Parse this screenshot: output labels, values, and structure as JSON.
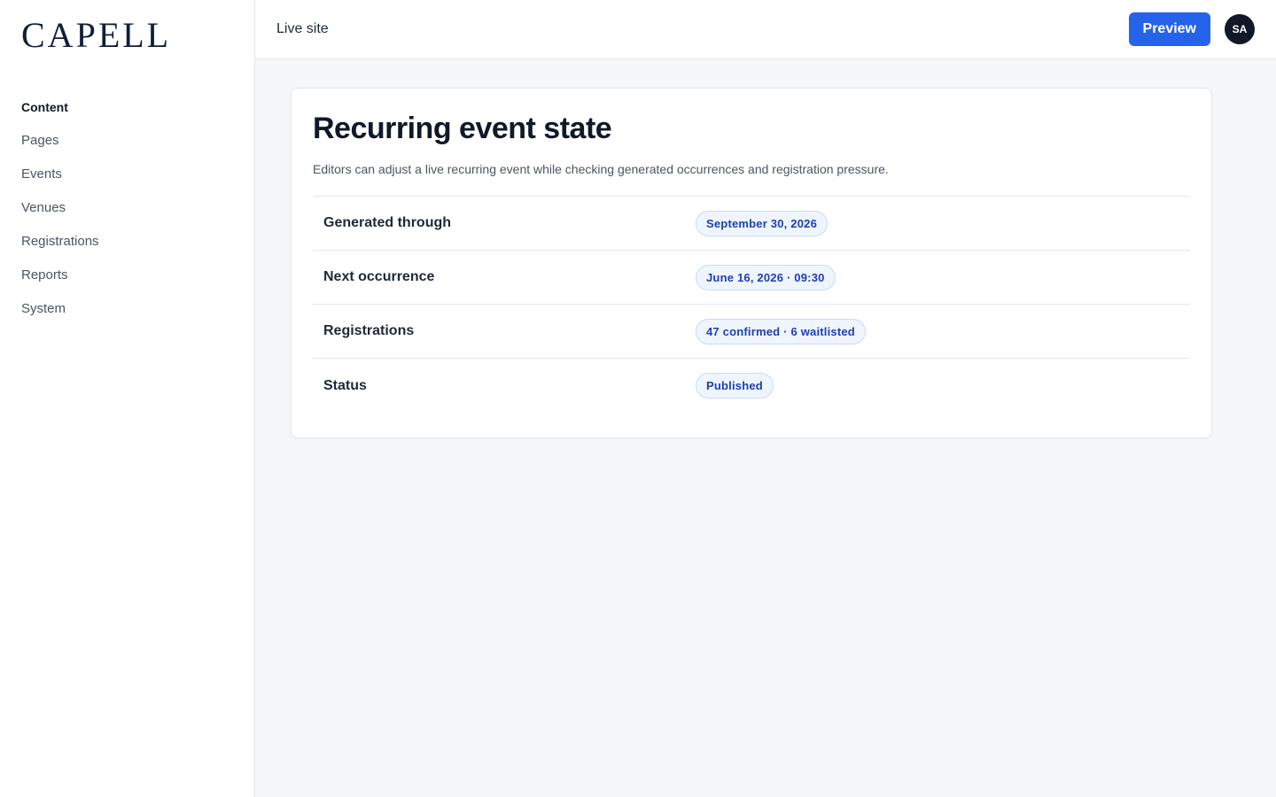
{
  "brand": {
    "logo_text": "CAPELL"
  },
  "sidebar": {
    "heading": "Content",
    "items": [
      {
        "label": "Pages"
      },
      {
        "label": "Events"
      },
      {
        "label": "Venues"
      },
      {
        "label": "Registrations"
      },
      {
        "label": "Reports"
      },
      {
        "label": "System"
      }
    ]
  },
  "topbar": {
    "live_site_label": "Live site",
    "preview_label": "Preview",
    "avatar_initials": "SA"
  },
  "card": {
    "title": "Recurring event state",
    "description": "Editors can adjust a live recurring event while checking generated occurrences and registration pressure.",
    "rows": [
      {
        "label": "Generated through",
        "value": "September 30, 2026"
      },
      {
        "label": "Next occurrence",
        "value": "June 16, 2026 · 09:30"
      },
      {
        "label": "Registrations",
        "value": "47 confirmed · 6 waitlisted"
      },
      {
        "label": "Status",
        "value": "Published"
      }
    ]
  },
  "colors": {
    "accent": "#2563eb",
    "pill_text": "#1e40af",
    "pill_bg": "#eff5ff",
    "brand": "#0f1f3a"
  }
}
